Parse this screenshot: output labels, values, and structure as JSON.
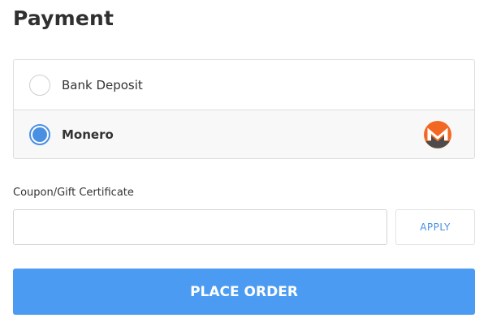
{
  "page": {
    "title": "Payment"
  },
  "payment_methods": [
    {
      "label": "Bank Deposit",
      "selected": false
    },
    {
      "label": "Monero",
      "selected": true,
      "icon": "monero-logo-icon"
    }
  ],
  "coupon": {
    "label": "Coupon/Gift Certificate",
    "value": "",
    "placeholder": "",
    "apply_label": "APPLY"
  },
  "actions": {
    "place_order_label": "PLACE ORDER"
  },
  "colors": {
    "accent": "#4a90e2",
    "place_order_bg": "#4a9bf1",
    "monero_orange": "#f26822",
    "monero_gray": "#4c4c4c"
  }
}
